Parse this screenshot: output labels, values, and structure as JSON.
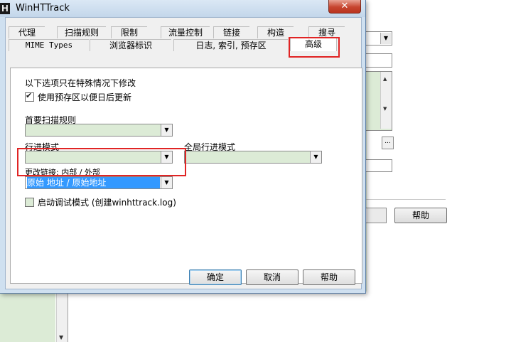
{
  "window": {
    "title": "WinHTTrack",
    "app_icon_letter": "H",
    "close_glyph": "✕"
  },
  "tabs_row1": [
    "代理",
    "扫描规则",
    "限制",
    "流量控制",
    "链接",
    "构造",
    "搜寻"
  ],
  "tabs_row2": [
    "MIME Types",
    "浏览器标识",
    "日志, 索引, 预存区",
    "高级"
  ],
  "panel": {
    "intro_text": "以下选项只在特殊情况下修改",
    "use_cache_checkbox": {
      "label": "使用预存区以便日后更新",
      "checked": true
    },
    "primary_scan_rule": {
      "label": "首要扫描规则",
      "value": ""
    },
    "travel_mode": {
      "label": "行进模式",
      "value": ""
    },
    "global_travel_mode": {
      "label": "全局行进模式",
      "value": ""
    },
    "rewrite_links": {
      "label": "更改链接: 内部 / 外部",
      "value": "原始 地址 / 原始地址"
    },
    "debug_mode_checkbox": {
      "label": "启动调试模式 (创建winhttrack.log)",
      "checked": false
    }
  },
  "buttons": {
    "ok": "确定",
    "cancel": "取消",
    "help": "帮助"
  },
  "background": {
    "help_button": "帮助"
  },
  "icons": {
    "dropdown": "▼",
    "scroll_up": "▲",
    "scroll_down": "▼",
    "ellipsis": "..."
  },
  "colors": {
    "highlight": "#e02424",
    "selection": "#3399ff",
    "field_green": "#dcebd6",
    "title_bar": "#cfe0f0"
  }
}
